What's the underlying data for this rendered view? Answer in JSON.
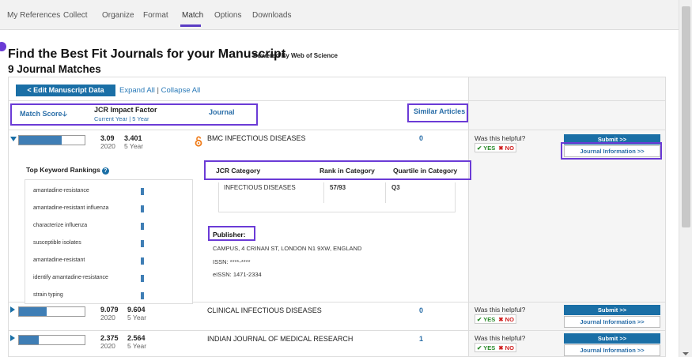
{
  "nav": {
    "tabs": [
      {
        "label": "My References"
      },
      {
        "label": "Collect"
      },
      {
        "label": "Organize"
      },
      {
        "label": "Format"
      },
      {
        "label": "Match"
      },
      {
        "label": "Options"
      },
      {
        "label": "Downloads"
      }
    ],
    "active": "Match"
  },
  "page": {
    "title": "Find the Best Fit Journals for your Manuscript",
    "powered_by": "Powered By Web of Science",
    "matches": "9 Journal Matches"
  },
  "toolbar": {
    "edit_label": "< Edit Manuscript Data",
    "expand_all": "Expand All",
    "separator": "|",
    "collapse_all": "Collapse All"
  },
  "columns": {
    "match_score": "Match Score",
    "jcr_impact": "JCR Impact Factor",
    "jcr_sub_current": "Current Year",
    "jcr_sub_sep": "|",
    "jcr_sub_5yr": "5 Year",
    "journal": "Journal",
    "similar": "Similar Articles"
  },
  "rows": [
    {
      "score_fraction": 0.65,
      "impact": "3.09",
      "impact_5yr": "3.401",
      "year": "2020",
      "five_year_label": "5 Year",
      "journal": "BMC INFECTIOUS DISEASES",
      "open_access": true,
      "similar": "0",
      "helpful": "Was this helpful?",
      "yes": "YES",
      "no": "NO",
      "submit": "Submit >>",
      "journal_info": "Journal Information >>",
      "expanded": true
    },
    {
      "score_fraction": 0.42,
      "impact": "9.079",
      "impact_5yr": "9.604",
      "year": "2020",
      "five_year_label": "5 Year",
      "journal": "CLINICAL INFECTIOUS DISEASES",
      "open_access": false,
      "similar": "0",
      "helpful": "Was this helpful?",
      "yes": "YES",
      "no": "NO",
      "submit": "Submit >>",
      "journal_info": "Journal Information >>",
      "expanded": false
    },
    {
      "score_fraction": 0.3,
      "impact": "2.375",
      "impact_5yr": "2.564",
      "year": "2020",
      "five_year_label": "5 Year",
      "journal": "INDIAN JOURNAL OF MEDICAL RESEARCH",
      "open_access": false,
      "similar": "1",
      "helpful": "Was this helpful?",
      "yes": "YES",
      "no": "NO",
      "submit": "Submit >>",
      "journal_info": "Journal Information >>",
      "expanded": false
    }
  ],
  "detail": {
    "keywords_title": "Top Keyword Rankings",
    "keywords": [
      "amantadine-resistance",
      "amantadine-resistant influenza",
      "characterize influenza",
      "susceptible isolates",
      "amantadine-resistant",
      "identify amantadine-resistance",
      "strain typing"
    ],
    "cat_header": "JCR Category",
    "rank_header": "Rank in Category",
    "quartile_header": "Quartile in Category",
    "category": "INFECTIOUS DISEASES",
    "rank": "57/93",
    "quartile": "Q3",
    "publisher_label": "Publisher:",
    "publisher_address": "CAMPUS, 4 CRINAN ST, LONDON N1 9XW, ENGLAND",
    "issn": "ISSN: ****-****",
    "eissn": "eISSN: 1471-2334"
  },
  "colors": {
    "accent": "#1a6fa6",
    "highlight": "#6b3bd6",
    "open_access": "#f07c1a"
  }
}
